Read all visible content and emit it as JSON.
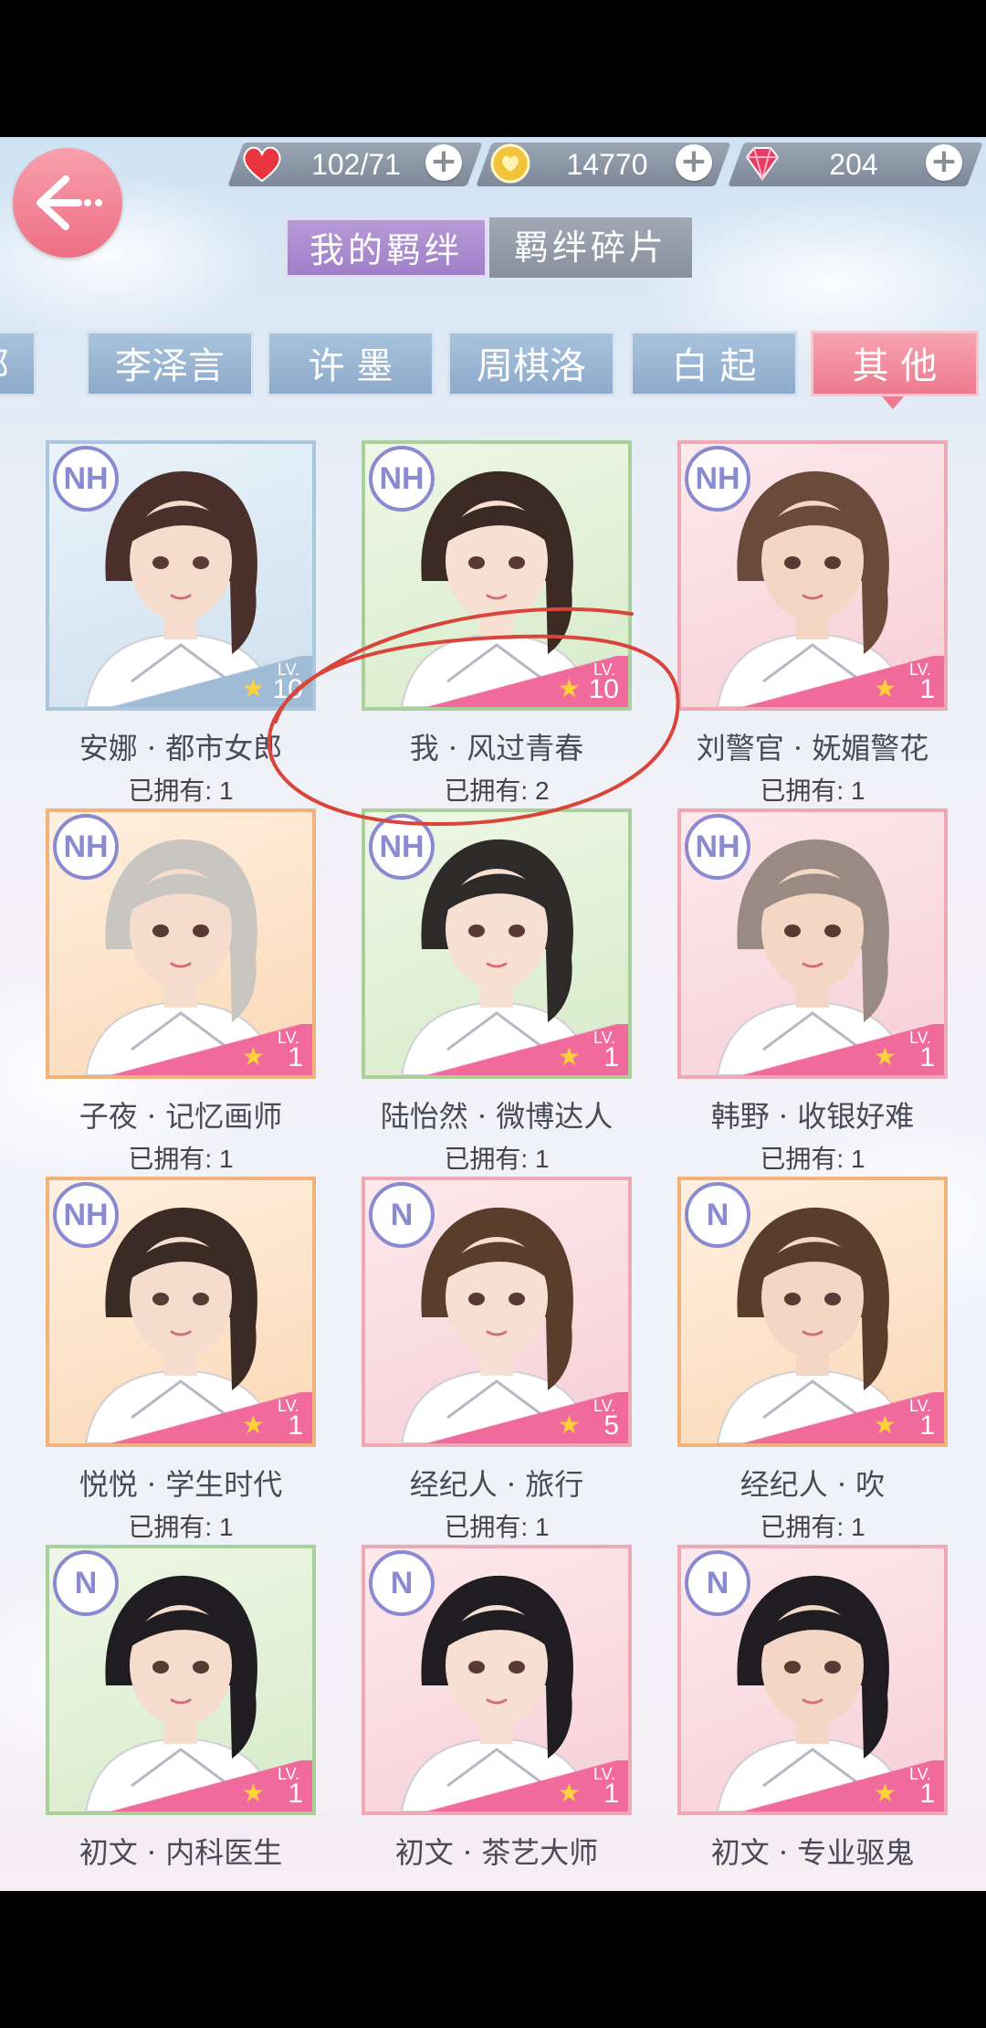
{
  "resources": {
    "stamina": {
      "icon": "heart-icon",
      "value": "102/71",
      "color": "#e8353e"
    },
    "coins": {
      "icon": "coin-icon",
      "value": "14770",
      "color": "#f2c23a"
    },
    "gems": {
      "icon": "gem-icon",
      "value": "204",
      "color": "#e83a62"
    }
  },
  "tabs": {
    "primary": [
      {
        "label": "我的羁绊",
        "active": true
      },
      {
        "label": "羁绊碎片",
        "active": false
      }
    ],
    "categories": [
      {
        "label": "部",
        "active": false
      },
      {
        "label": "李泽言",
        "active": false
      },
      {
        "label": "许 墨",
        "active": false
      },
      {
        "label": "周棋洛",
        "active": false
      },
      {
        "label": "白 起",
        "active": false
      },
      {
        "label": "其 他",
        "active": true
      }
    ]
  },
  "cards": [
    {
      "name": "安娜 · 都市女郎",
      "owned": "已拥有: 1",
      "rank": "NH",
      "level": "10",
      "lv": "LV.",
      "bg": "blue"
    },
    {
      "name": "我 · 风过青春",
      "owned": "已拥有: 2",
      "rank": "NH",
      "level": "10",
      "lv": "LV.",
      "bg": "green"
    },
    {
      "name": "刘警官 · 妩媚警花",
      "owned": "已拥有: 1",
      "rank": "NH",
      "level": "1",
      "lv": "LV.",
      "bg": "pink"
    },
    {
      "name": "子夜 · 记忆画师",
      "owned": "已拥有: 1",
      "rank": "NH",
      "level": "1",
      "lv": "LV.",
      "bg": "orange"
    },
    {
      "name": "陆怡然 · 微博达人",
      "owned": "已拥有: 1",
      "rank": "NH",
      "level": "1",
      "lv": "LV.",
      "bg": "green"
    },
    {
      "name": "韩野 · 收银好难",
      "owned": "已拥有: 1",
      "rank": "NH",
      "level": "1",
      "lv": "LV.",
      "bg": "pink"
    },
    {
      "name": "悦悦 · 学生时代",
      "owned": "已拥有: 1",
      "rank": "NH",
      "level": "1",
      "lv": "LV.",
      "bg": "orange"
    },
    {
      "name": "经纪人 · 旅行",
      "owned": "已拥有: 1",
      "rank": "N",
      "level": "5",
      "lv": "LV.",
      "bg": "pink"
    },
    {
      "name": "经纪人 · 吹",
      "owned": "已拥有: 1",
      "rank": "N",
      "level": "1",
      "lv": "LV.",
      "bg": "orange"
    },
    {
      "name": "初文 · 内科医生",
      "owned": "",
      "rank": "N",
      "level": "1",
      "lv": "LV.",
      "bg": "green"
    },
    {
      "name": "初文 · 茶艺大师",
      "owned": "",
      "rank": "N",
      "level": "1",
      "lv": "LV.",
      "bg": "pink"
    },
    {
      "name": "初文 · 专业驱鬼",
      "owned": "",
      "rank": "N",
      "level": "1",
      "lv": "LV.",
      "bg": "pink"
    }
  ]
}
